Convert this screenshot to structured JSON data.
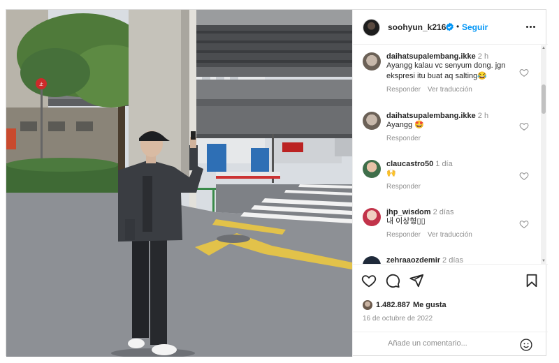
{
  "post": {
    "username": "soohyun_k216",
    "separator": "•",
    "follow_label": "Seguir",
    "likes_count": "1.482.887",
    "likes_label": "Me gusta",
    "date": "16 de octubre de 2022",
    "comment_placeholder": "Añade un comentario..."
  },
  "comments": [
    {
      "user": "daihatsupalembang.ikke",
      "time": "2 h",
      "text": "Ayangg kalau vc senyum dong. jgn ekspresi itu buat aq salting😂",
      "reply_label": "Responder",
      "translate_label": "Ver traducción"
    },
    {
      "user": "daihatsupalembang.ikke",
      "time": "2 h",
      "text": "Ayangg 🤩",
      "reply_label": "Responder"
    },
    {
      "user": "claucastro50",
      "time": "1 día",
      "text": "🙌",
      "reply_label": "Responder"
    },
    {
      "user": "jhp_wisdom",
      "time": "2 días",
      "text": "내 이상형▯▯",
      "reply_label": "Responder",
      "translate_label": "Ver traducción"
    },
    {
      "user": "zehraaozdemir",
      "time": "2 días"
    }
  ],
  "photo": {
    "signs": [
      "止まれ",
      "止"
    ]
  },
  "colors": {
    "accent": "#0095f6",
    "text": "#262626",
    "muted": "#8e8e8e",
    "border": "#dbdbdb"
  },
  "icons": {
    "like": "heart-icon",
    "comment": "comment-icon",
    "share": "paper-plane-icon",
    "save": "bookmark-icon",
    "more": "more-options-icon",
    "emoji": "smiley-icon",
    "verified": "verified-badge-icon"
  }
}
